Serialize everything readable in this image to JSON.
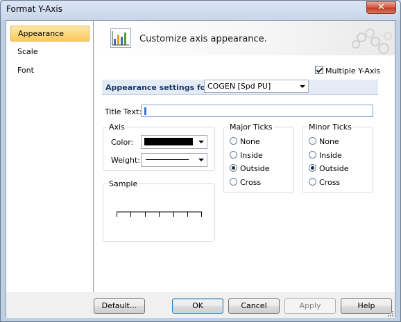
{
  "window": {
    "title": "Format Y-Axis",
    "close_glyph": "✕"
  },
  "sidebar": {
    "items": [
      {
        "label": "Appearance",
        "selected": true
      },
      {
        "label": "Scale",
        "selected": false
      },
      {
        "label": "Font",
        "selected": false
      }
    ]
  },
  "header": {
    "text": "Customize axis appearance.",
    "icon": "chart-settings-icon"
  },
  "options": {
    "multiple_y_axis_label": "Multiple Y-Axis",
    "multiple_y_axis_checked": true
  },
  "settings": {
    "label": "Appearance settings for:",
    "selected": "COGEN [Spd PU]"
  },
  "title_text": {
    "label": "Title Text:",
    "value": ""
  },
  "axis": {
    "group_label": "Axis",
    "color_label": "Color:",
    "color_value": "#000000",
    "weight_label": "Weight:"
  },
  "major_ticks": {
    "group_label": "Major Ticks",
    "options": [
      "None",
      "Inside",
      "Outside",
      "Cross"
    ],
    "selected": "Outside"
  },
  "minor_ticks": {
    "group_label": "Minor Ticks",
    "options": [
      "None",
      "Inside",
      "Outside",
      "Cross"
    ],
    "selected": "Outside"
  },
  "sample": {
    "group_label": "Sample"
  },
  "buttons": {
    "default": "Default...",
    "ok": "OK",
    "cancel": "Cancel",
    "apply": "Apply",
    "help": "Help"
  },
  "colors": {
    "selection": "#f9c95c",
    "settings_label": "#1b3a66"
  }
}
